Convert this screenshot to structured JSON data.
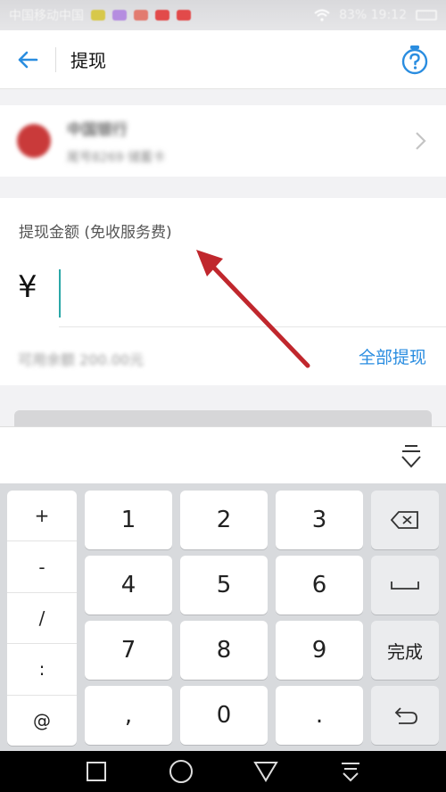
{
  "status_bar": {
    "carrier": "中国移动中国",
    "right_text": "83% 19:12"
  },
  "header": {
    "title": "提现"
  },
  "bank_card": {
    "name": "中国银行",
    "sub": "尾号8269 储蓄卡"
  },
  "amount": {
    "label": "提现金额 (免收服务费)",
    "currency_symbol": "¥",
    "input_value": "",
    "balance_text": "可用余额 200.00元",
    "withdraw_all": "全部提现"
  },
  "keyboard": {
    "symbols": [
      "+",
      "-",
      "/",
      ":",
      "@"
    ],
    "digits": [
      "1",
      "2",
      "3",
      "4",
      "5",
      "6",
      "7",
      "8",
      "9",
      ",",
      "0",
      "."
    ],
    "done_label": "完成"
  },
  "colors": {
    "accent": "#2a8de0",
    "cursor": "#2aa7a7",
    "arrow": "#c0272d"
  }
}
